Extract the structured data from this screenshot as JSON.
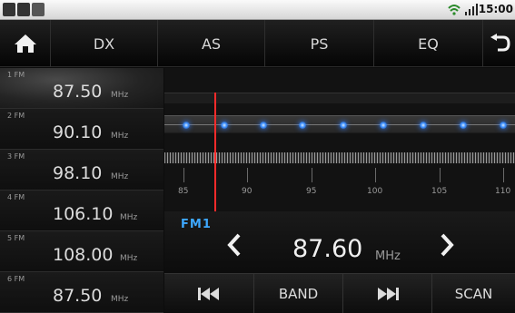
{
  "status_bar": {
    "time": "15:00"
  },
  "menu": {
    "dx": "DX",
    "as": "AS",
    "ps": "PS",
    "eq": "EQ"
  },
  "presets": [
    {
      "num": "1 FM",
      "freq": "87.50",
      "unit": "MHz",
      "selected": true
    },
    {
      "num": "2 FM",
      "freq": "90.10",
      "unit": "MHz"
    },
    {
      "num": "3 FM",
      "freq": "98.10",
      "unit": "MHz"
    },
    {
      "num": "4 FM",
      "freq": "106.10",
      "unit": "MHz"
    },
    {
      "num": "5 FM",
      "freq": "108.00",
      "unit": "MHz"
    },
    {
      "num": "6 FM",
      "freq": "87.50",
      "unit": "MHz"
    }
  ],
  "scale": {
    "labels": [
      "85",
      "90",
      "95",
      "100",
      "105",
      "110"
    ]
  },
  "tuner": {
    "band": "FM1",
    "frequency": "87.60",
    "unit": "MHz"
  },
  "controls": {
    "band": "BAND",
    "scan": "SCAN"
  },
  "colors": {
    "accent": "#3ea8ff",
    "needle": "#ff2b2b"
  },
  "icons": [
    "home-icon",
    "back-icon",
    "chevron-left-icon",
    "chevron-right-icon",
    "previous-track-icon",
    "next-track-icon",
    "wifi-icon",
    "signal-icon"
  ]
}
